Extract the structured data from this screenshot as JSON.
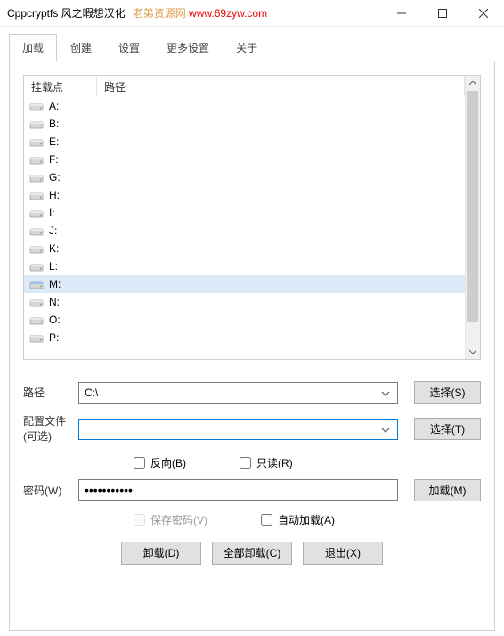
{
  "title": "Cppcryptfs 风之暇想汉化",
  "watermark_a": "老弟资源网",
  "watermark_b": "www.69zyw.com",
  "tabs": [
    "加载",
    "创建",
    "设置",
    "更多设置",
    "关于"
  ],
  "columns": {
    "mount_point": "挂载点",
    "path": "路径"
  },
  "drives": [
    "A:",
    "B:",
    "E:",
    "F:",
    "G:",
    "H:",
    "I:",
    "J:",
    "K:",
    "L:",
    "M:",
    "N:",
    "O:",
    "P:"
  ],
  "selected_drive": "M:",
  "labels": {
    "path": "路径",
    "config": "配置文件",
    "optional": "(可选)",
    "password": "密码(W)"
  },
  "path_value": "C:\\",
  "config_value": "",
  "checkboxes": {
    "reverse": "反向(B)",
    "readonly": "只读(R)",
    "savepw": "保存密码(V)",
    "automount": "自动加载(A)"
  },
  "buttons": {
    "select_s": "选择(S)",
    "select_t": "选择(T)",
    "mount": "加载(M)",
    "dismount": "卸载(D)",
    "dismount_all": "全部卸载(C)",
    "exit": "退出(X)"
  },
  "password_mask": "•••••••••••"
}
